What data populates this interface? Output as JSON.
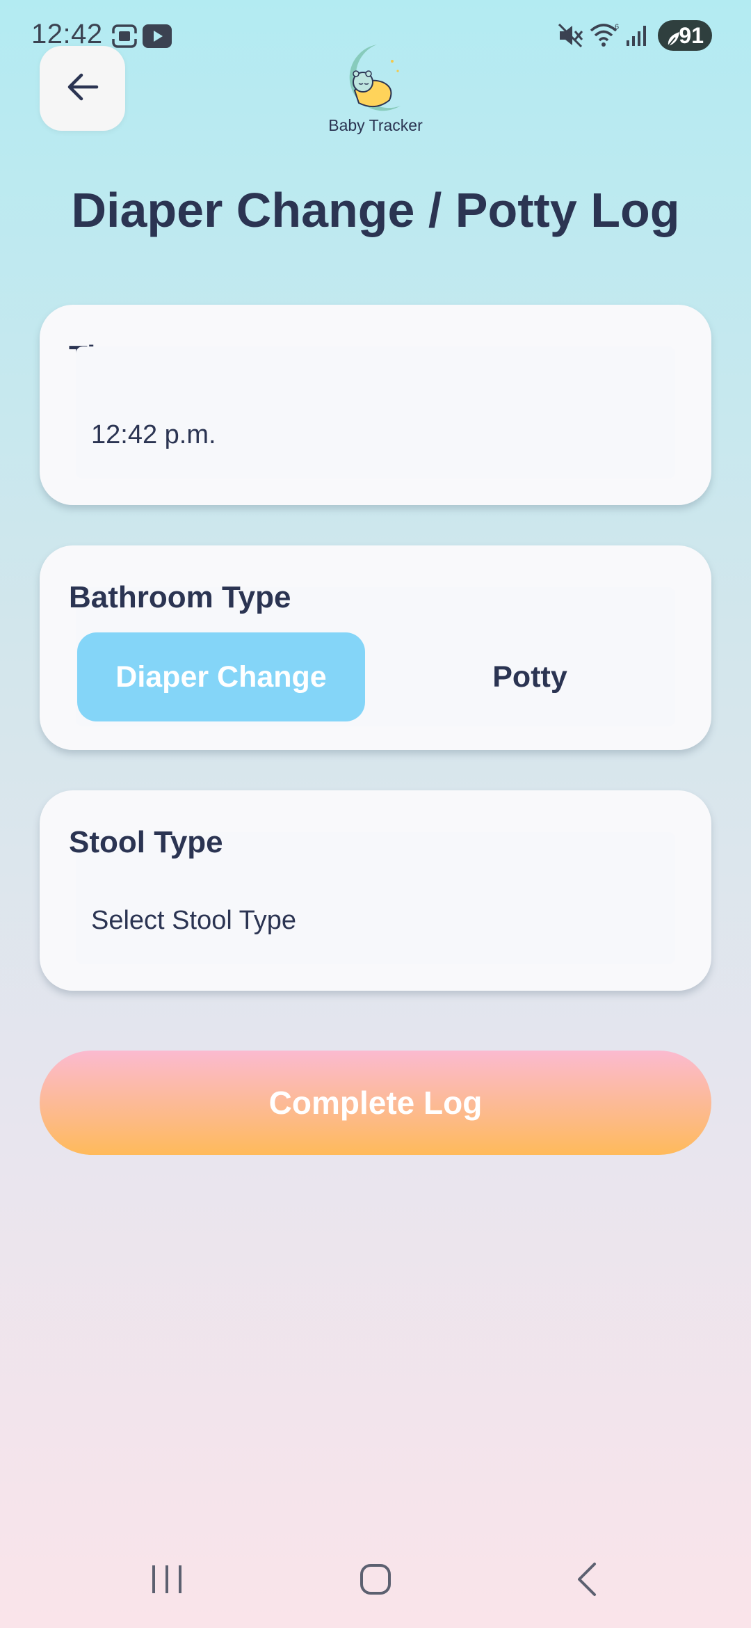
{
  "status_bar": {
    "time": "12:42",
    "battery": "91",
    "icons": [
      "screenshot-icon",
      "youtube-icon",
      "mute-icon",
      "wifi-icon",
      "signal-icon",
      "battery-icon"
    ]
  },
  "header": {
    "back_icon": "arrow-left-icon",
    "logo_label": "Baby Tracker"
  },
  "page": {
    "title": "Diaper Change / Potty Log"
  },
  "time_card": {
    "label": "Time",
    "value": "12:42 p.m."
  },
  "bathroom_card": {
    "label": "Bathroom Type",
    "options": [
      "Diaper Change",
      "Potty"
    ],
    "selected": "Diaper Change"
  },
  "stool_card": {
    "label": "Stool Type",
    "placeholder": "Select Stool Type"
  },
  "actions": {
    "complete_label": "Complete Log"
  },
  "colors": {
    "accent_selected": "#84d5f8",
    "text_primary": "#2b3452",
    "button_gradient_top": "#fbbad0",
    "button_gradient_bottom": "#ffba5a"
  },
  "nav_bar": {
    "icons": [
      "recents-icon",
      "home-icon",
      "back-nav-icon"
    ]
  }
}
